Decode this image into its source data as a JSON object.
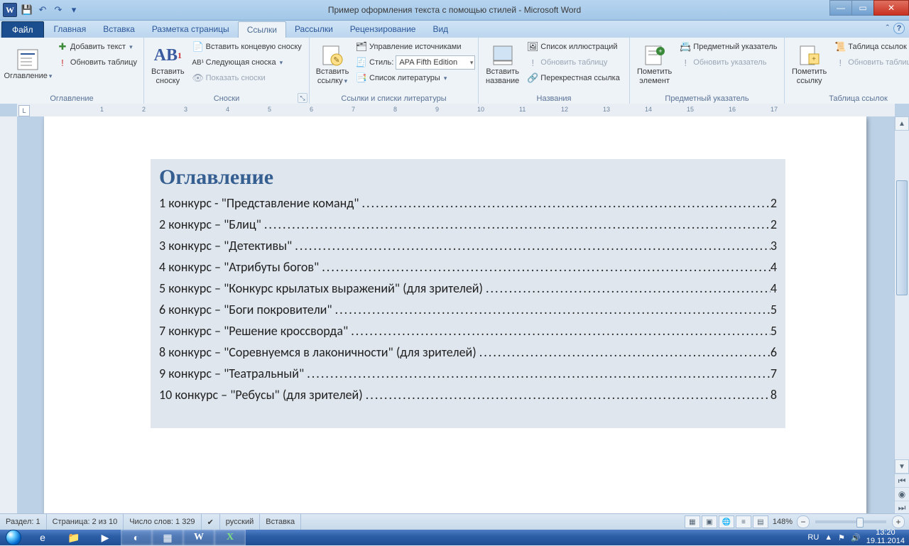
{
  "window": {
    "title": "Пример оформления текста с помощью стилей  -  Microsoft Word"
  },
  "file_tab": "Файл",
  "tabs": [
    "Главная",
    "Вставка",
    "Разметка страницы",
    "Ссылки",
    "Рассылки",
    "Рецензирование",
    "Вид"
  ],
  "active_tab_index": 3,
  "ribbon": {
    "toc": {
      "btn": "Оглавление",
      "add_text": "Добавить текст",
      "update": "Обновить таблицу",
      "group": "Оглавление"
    },
    "footnotes": {
      "insert": "Вставить\nсноску",
      "endnote": "Вставить концевую сноску",
      "next": "Следующая сноска",
      "show": "Показать сноски",
      "group": "Сноски"
    },
    "citations": {
      "insert": "Вставить\nссылку",
      "manage": "Управление источниками",
      "style_label": "Стиль:",
      "style_value": "APA Fifth Edition",
      "biblio": "Список литературы",
      "group": "Ссылки и списки литературы"
    },
    "captions": {
      "insert": "Вставить\nназвание",
      "list": "Список иллюстраций",
      "update": "Обновить таблицу",
      "cross": "Перекрестная ссылка",
      "group": "Названия"
    },
    "index": {
      "mark": "Пометить\nэлемент",
      "insert": "Предметный указатель",
      "update": "Обновить указатель",
      "group": "Предметный указатель"
    },
    "toa": {
      "mark": "Пометить\nссылку",
      "insert": "Таблица ссылок",
      "update": "Обновить таблицу",
      "group": "Таблица ссылок"
    }
  },
  "ruler_numbers": [
    "1",
    "2",
    "1",
    "2",
    "3",
    "4",
    "5",
    "6",
    "7",
    "8",
    "9",
    "10",
    "11",
    "12",
    "13",
    "14",
    "15",
    "16",
    "17"
  ],
  "doc": {
    "toc_title": "Оглавление",
    "entries": [
      {
        "text": "1 конкурс - \"Представление команд\"",
        "page": "2"
      },
      {
        "text": "2 конкурс – \"Блиц\"",
        "page": "2"
      },
      {
        "text": "3 конкурс – \"Детективы\"",
        "page": "3"
      },
      {
        "text": "4 конкурс – \"Атрибуты богов\"",
        "page": "4"
      },
      {
        "text": "5 конкурс – \"Конкурс крылатых выражений\" (для зрителей)",
        "page": "4"
      },
      {
        "text": "6 конкурс – \"Боги покровители\"",
        "page": "5"
      },
      {
        "text": "7 конкурс – \"Решение кроссворда\"",
        "page": "5"
      },
      {
        "text": "8 конкурс – \"Соревнуемся в лаконичности\" (для зрителей)",
        "page": "6"
      },
      {
        "text": "9 конкурс – \"Театральный\"",
        "page": "7"
      },
      {
        "text": "10 конкурс – \"Ребусы\" (для зрителей)",
        "page": "8"
      }
    ]
  },
  "status": {
    "section": "Раздел: 1",
    "page": "Страница: 2 из 10",
    "words": "Число слов: 1 329",
    "lang": "русский",
    "mode": "Вставка",
    "zoom": "148%"
  },
  "tray": {
    "lang": "RU",
    "time": "13:20",
    "date": "19.11.2014"
  }
}
